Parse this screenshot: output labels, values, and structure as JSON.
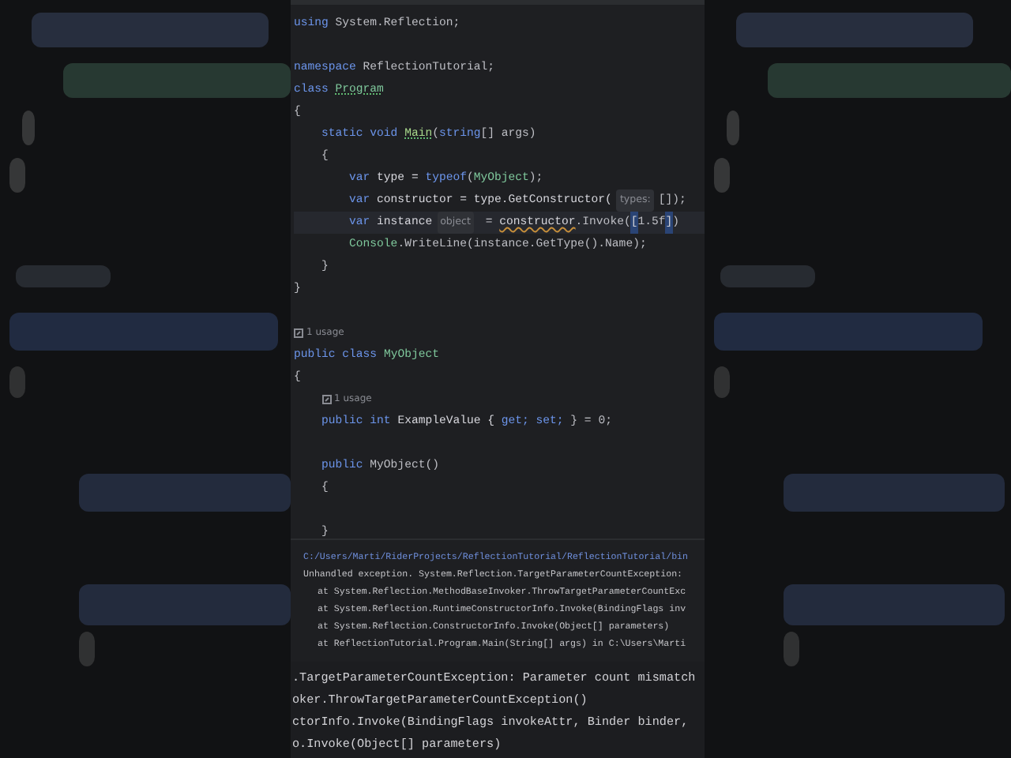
{
  "editor": {
    "lines": [
      {
        "segments": [
          {
            "text": "using ",
            "kind": "keyword"
          },
          {
            "text": "System.Reflection;",
            "kind": "text"
          }
        ]
      },
      {
        "blank_line_before": true,
        "segments": [
          {
            "text": "namespace ",
            "kind": "keyword"
          },
          {
            "text": "ReflectionTutorial;",
            "kind": "text"
          }
        ]
      },
      {
        "segments": [
          {
            "text": "class ",
            "kind": "keyword"
          },
          {
            "text": "Program",
            "kind": "type",
            "weak_warning": true
          }
        ]
      },
      {
        "segments": [
          {
            "text": "{",
            "kind": "text"
          }
        ]
      },
      {
        "segments": [
          {
            "text": "    static void ",
            "kind": "keyword"
          },
          {
            "text": "Main",
            "kind": "method",
            "weak_warning": true
          },
          {
            "text": "(",
            "kind": "text"
          },
          {
            "text": "string",
            "kind": "keyword"
          },
          {
            "text": "[] args)",
            "kind": "text"
          }
        ]
      },
      {
        "segments": [
          {
            "text": "    {",
            "kind": "text"
          }
        ]
      },
      {
        "segments": [
          {
            "text": "        var ",
            "kind": "keyword"
          },
          {
            "text": "type = ",
            "kind": "local"
          },
          {
            "text": "typeof",
            "kind": "keyword"
          },
          {
            "text": "(",
            "kind": "text"
          },
          {
            "text": "MyObject",
            "kind": "type"
          },
          {
            "text": ");",
            "kind": "text"
          }
        ]
      },
      {
        "segments": [
          {
            "text": "        var ",
            "kind": "keyword"
          },
          {
            "text": "constructor = type.GetConstructor(",
            "kind": "local"
          },
          {
            "text": "types:",
            "kind": "hint"
          },
          {
            "text": "[]);",
            "kind": "text"
          }
        ]
      },
      {
        "current": true,
        "segments": [
          {
            "text": "        var ",
            "kind": "keyword"
          },
          {
            "text": "instance",
            "kind": "local"
          },
          {
            "text": "object",
            "kind": "hint"
          },
          {
            "text": " = ",
            "kind": "text"
          },
          {
            "text": "constructor",
            "kind": "local",
            "warning": true
          },
          {
            "text": ".Invoke(",
            "kind": "text"
          },
          {
            "text": "[",
            "kind": "match"
          },
          {
            "text": "1.5f",
            "kind": "text"
          },
          {
            "text": "]",
            "kind": "match"
          },
          {
            "text": ")",
            "kind": "text"
          }
        ]
      },
      {
        "segments": [
          {
            "text": "        Console",
            "kind": "type"
          },
          {
            "text": ".WriteLine(instance.GetType().Name);",
            "kind": "text"
          }
        ]
      },
      {
        "segments": [
          {
            "text": "    }",
            "kind": "text"
          }
        ]
      },
      {
        "segments": [
          {
            "text": "}",
            "kind": "text"
          }
        ]
      },
      {
        "blank_line_before": true,
        "segments": [
          {
            "text": "1 usage",
            "kind": "usage"
          }
        ]
      },
      {
        "segments": [
          {
            "text": "public class ",
            "kind": "keyword"
          },
          {
            "text": "MyObject",
            "kind": "type"
          }
        ]
      },
      {
        "segments": [
          {
            "text": "{",
            "kind": "text"
          }
        ]
      },
      {
        "segments": [
          {
            "text": "1 usage",
            "kind": "usage"
          }
        ]
      },
      {
        "segments": [
          {
            "text": "    public int ",
            "kind": "keyword"
          },
          {
            "text": "ExampleValue { ",
            "kind": "local"
          },
          {
            "text": "get; set;",
            "kind": "keyword"
          },
          {
            "text": " } = 0;",
            "kind": "text"
          }
        ]
      },
      {
        "blank_line_before": true,
        "segments": [
          {
            "text": "    public ",
            "kind": "keyword"
          },
          {
            "text": "MyObject()",
            "kind": "text"
          }
        ]
      },
      {
        "segments": [
          {
            "text": "    {",
            "kind": "text"
          }
        ]
      },
      {
        "blank_line_before": true,
        "segments": [
          {
            "text": "    }",
            "kind": "text"
          }
        ]
      }
    ]
  },
  "console": {
    "lines": [
      {
        "kind": "path",
        "text": "C:/Users/Marti/RiderProjects/ReflectionTutorial/ReflectionTutorial/bin"
      },
      {
        "kind": "message",
        "text": "Unhandled exception. System.Reflection.TargetParameterCountException:"
      },
      {
        "kind": "frame",
        "text": "at System.Reflection.MethodBaseInvoker.ThrowTargetParameterCountExc"
      },
      {
        "kind": "frame",
        "text": "at System.Reflection.RuntimeConstructorInfo.Invoke(BindingFlags inv"
      },
      {
        "kind": "frame",
        "text": "at System.Reflection.ConstructorInfo.Invoke(Object[] parameters)"
      },
      {
        "kind": "frame",
        "text": "at ReflectionTutorial.Program.Main(String[] args) in C:\\Users\\Marti"
      }
    ]
  },
  "zoomed_console": {
    "lines": [
      ".TargetParameterCountException: Parameter count mismatch",
      "oker.ThrowTargetParameterCountException()",
      "ctorInfo.Invoke(BindingFlags invokeAttr, Binder binder,",
      "o.Invoke(Object[] parameters)"
    ]
  }
}
